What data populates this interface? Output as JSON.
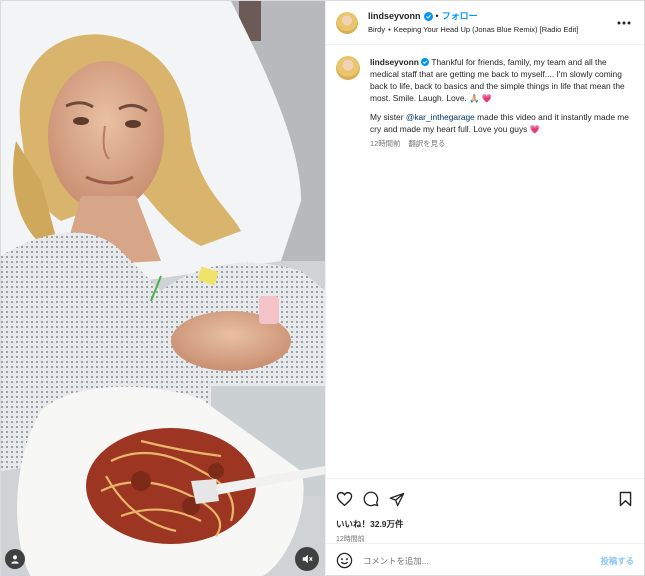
{
  "post": {
    "username": "lindseyvonn",
    "verified": true,
    "follow_label": "フォロー",
    "audio": {
      "artist": "Birdy",
      "track": "Keeping Your Head Up (Jonas Blue Remix) [Radio Edit]"
    },
    "more_icon": "more-horizontal-icon"
  },
  "caption": {
    "username": "lindseyvonn",
    "paragraph1": "Thankful for friends, family, my team and all the medical staff that are getting me back to myself.... I'm slowly coming back to life, back to basics and the simple things in life that mean the most. Smile. Laugh. Love. 🙏🏼 💗",
    "paragraph2_before": "My sister ",
    "paragraph2_mention": "@kar_inthegarage",
    "paragraph2_after": " made this video and it instantly made me cry and made my heart full. Love you guys 💗",
    "time": "12時間前",
    "translate": "翻訳を見る"
  },
  "actions": {
    "like_icon": "heart-icon",
    "comment_icon": "comment-icon",
    "share_icon": "share-icon",
    "save_icon": "bookmark-icon"
  },
  "likes": "いいね！32.9万件",
  "time_ago": "12時間前",
  "comment": {
    "emoji_icon": "emoji-icon",
    "placeholder": "コメントを追加...",
    "post_label": "投稿する"
  },
  "colors": {
    "accent": "#0095f6",
    "post_disabled": "#8ac7f7",
    "verified": "#0095f6"
  }
}
